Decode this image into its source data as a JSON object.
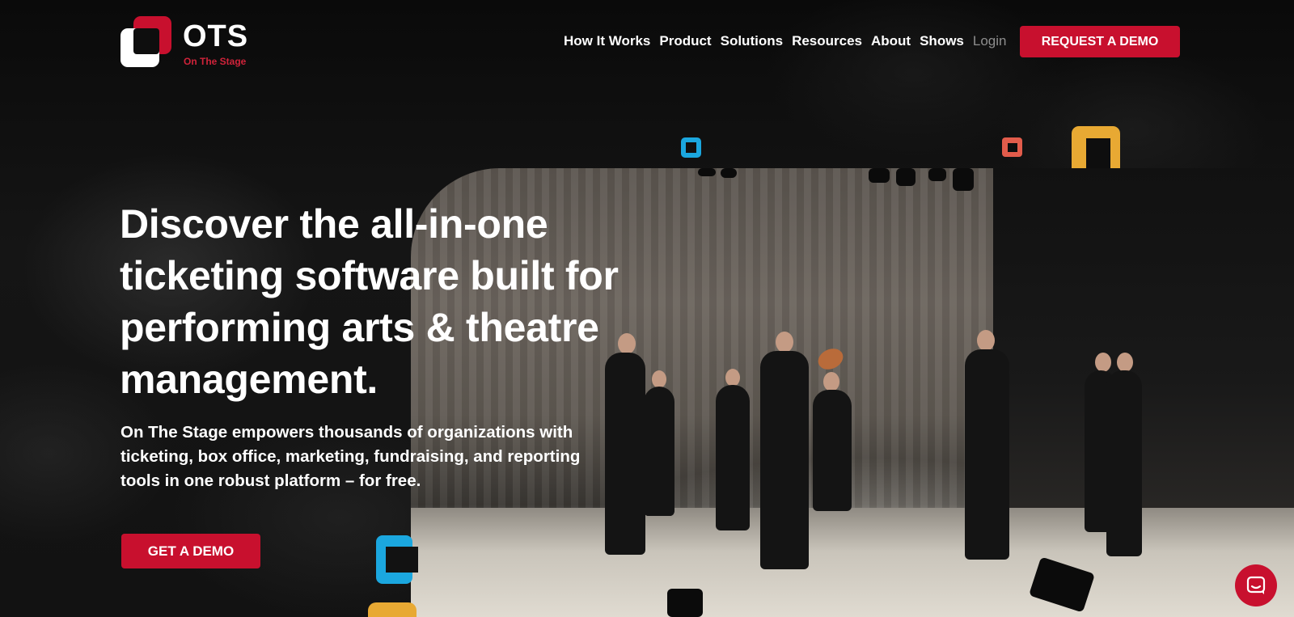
{
  "logo": {
    "text": "OTS",
    "subtitle": "On The Stage"
  },
  "nav": {
    "items": [
      "How It Works",
      "Product",
      "Solutions",
      "Resources",
      "About",
      "Shows"
    ],
    "login": "Login"
  },
  "header_cta": "REQUEST A DEMO",
  "hero": {
    "title": "Discover the all-in-one ticketing software built for performing arts & theatre management.",
    "subtitle": "On The Stage empowers thousands of organizations with ticketing, box office, marketing, fundraising, and reporting tools in one robust platform – for free.",
    "cta": "GET A DEMO"
  },
  "colors": {
    "brand_red": "#c8102e",
    "accent_blue": "#1ba7df",
    "accent_gold": "#e8a933",
    "accent_coral": "#e25c4b"
  },
  "icons": {
    "chat": "chat-bubble-icon"
  }
}
